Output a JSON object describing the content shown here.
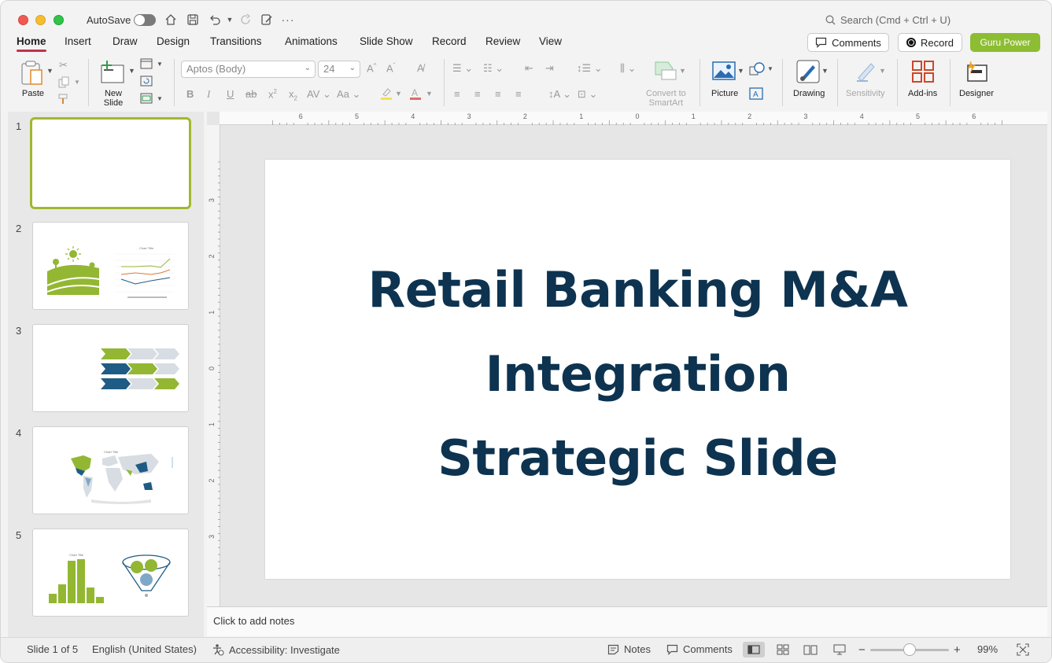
{
  "titlebar": {
    "autosave_label": "AutoSave",
    "search_placeholder": "Search (Cmd + Ctrl + U)"
  },
  "ribbon_tabs": [
    "Home",
    "Insert",
    "Draw",
    "Design",
    "Transitions",
    "Animations",
    "Slide Show",
    "Record",
    "Review",
    "View"
  ],
  "header_buttons": {
    "comments": "Comments",
    "record": "Record",
    "guru": "Guru Power"
  },
  "ribbon": {
    "paste": "Paste",
    "new_slide_line1": "New",
    "new_slide_line2": "Slide",
    "font_name": "Aptos (Body)",
    "font_size": "24",
    "convert_line1": "Convert to",
    "convert_line2": "SmartArt",
    "picture": "Picture",
    "drawing": "Drawing",
    "sensitivity": "Sensitivity",
    "addins": "Add-ins",
    "designer": "Designer"
  },
  "thumbnails": [
    {
      "num": "1"
    },
    {
      "num": "2"
    },
    {
      "num": "3"
    },
    {
      "num": "4"
    },
    {
      "num": "5"
    }
  ],
  "slide": {
    "title_line1": "Retail Banking M&A",
    "title_line2": "Integration",
    "title_line3": "Strategic Slide"
  },
  "ruler": {
    "top_labels": [
      "6",
      "5",
      "4",
      "3",
      "2",
      "1",
      "0",
      "1",
      "2",
      "3",
      "4",
      "5",
      "6"
    ],
    "left_labels": [
      "3",
      "2",
      "1",
      "0",
      "1",
      "2",
      "3"
    ]
  },
  "notes_placeholder": "Click to add notes",
  "status": {
    "slide_info": "Slide 1 of 5",
    "language": "English (United States)",
    "accessibility": "Accessibility: Investigate",
    "notes": "Notes",
    "comments": "Comments",
    "zoom": "99%"
  },
  "colors": {
    "title_text": "#0d3350",
    "accent_green": "#8dbd32",
    "tab_underline": "#c4314b",
    "dark_blue": "#1f5c85"
  }
}
